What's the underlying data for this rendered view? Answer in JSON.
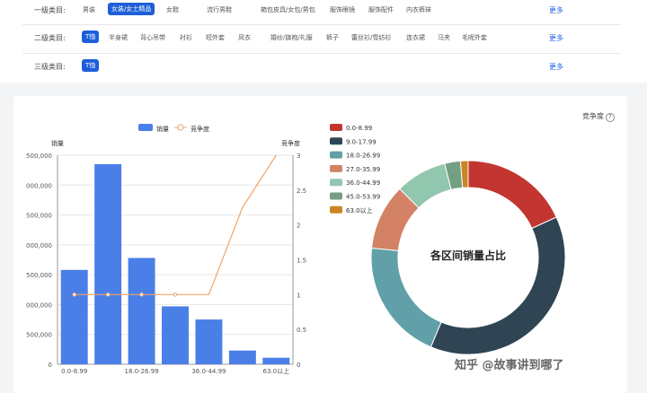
{
  "filters": {
    "level1": {
      "label": "一级类目:",
      "items": [
        "男装",
        "女装/女士精品",
        "女鞋",
        "流行男鞋",
        "箱包皮具/女包/男包",
        "服饰眼镜",
        "服饰配件",
        "内衣裤袜"
      ],
      "active": 1,
      "more": "更多"
    },
    "level2": {
      "label": "二级类目:",
      "items": [
        "T恤",
        "半身裙",
        "背心吊带",
        "衬衫",
        "短外套",
        "风衣",
        "婚纱/旗袍/礼服",
        "裤子",
        "蕾丝衫/雪纺衫",
        "连衣裙",
        "马夹",
        "毛呢外套"
      ],
      "active": 0,
      "more": "更多"
    },
    "level3": {
      "label": "三级类目:",
      "items": [
        "T恤"
      ],
      "active": 0,
      "more": "更多"
    }
  },
  "competition_link": "竞争度",
  "watermark": "知乎 @故事讲到哪了",
  "chart_data": [
    {
      "type": "bar",
      "legend": [
        "销量",
        "竞争度"
      ],
      "ylabel": "销量",
      "y2label": "竞争度",
      "categories": [
        "0.0-8.99",
        "9.0-17.99",
        "18.0-26.99",
        "27.0-35.99",
        "36.0-44.99",
        "45.0-53.99",
        "63.0以上"
      ],
      "x_tick_labels": [
        "0.0-8.99",
        "18.0-26.99",
        "36.0-44.99",
        "63.0以上"
      ],
      "series": [
        {
          "name": "销量",
          "type": "bar",
          "values": [
            1580000,
            3350000,
            1780000,
            970000,
            750000,
            230000,
            110000
          ]
        },
        {
          "name": "竞争度",
          "type": "line",
          "axis": "right",
          "values": [
            1,
            1,
            1,
            1,
            1,
            2.25,
            3
          ]
        }
      ],
      "y_ticks": [
        "0",
        "500,000",
        "000,000",
        "500,000",
        "000,000",
        "500,000",
        "000,000",
        "500,000"
      ],
      "y2_ticks": [
        "0",
        "0.5",
        "1",
        "1.5",
        "2",
        "2.5",
        "3"
      ],
      "ylim": [
        0,
        3500000
      ],
      "y2lim": [
        0,
        3
      ],
      "colors": {
        "bar": "#4a7fe8",
        "line": "#f0a46a"
      }
    },
    {
      "type": "pie",
      "variant": "donut",
      "center_label": "各区间销量占比",
      "labels": [
        "0.0-8.99",
        "9.0-17.99",
        "18.0-26.99",
        "27.0-35.99",
        "36.0-44.99",
        "45.0-53.99",
        "63.0以上"
      ],
      "values": [
        17.2,
        36.1,
        19.2,
        10.4,
        8.1,
        2.5,
        1.2
      ],
      "colors": [
        "#c23531",
        "#2f4554",
        "#61a0a8",
        "#d48265",
        "#91c7ae",
        "#749f83",
        "#ca8622"
      ],
      "legend_position": "top-left"
    }
  ]
}
